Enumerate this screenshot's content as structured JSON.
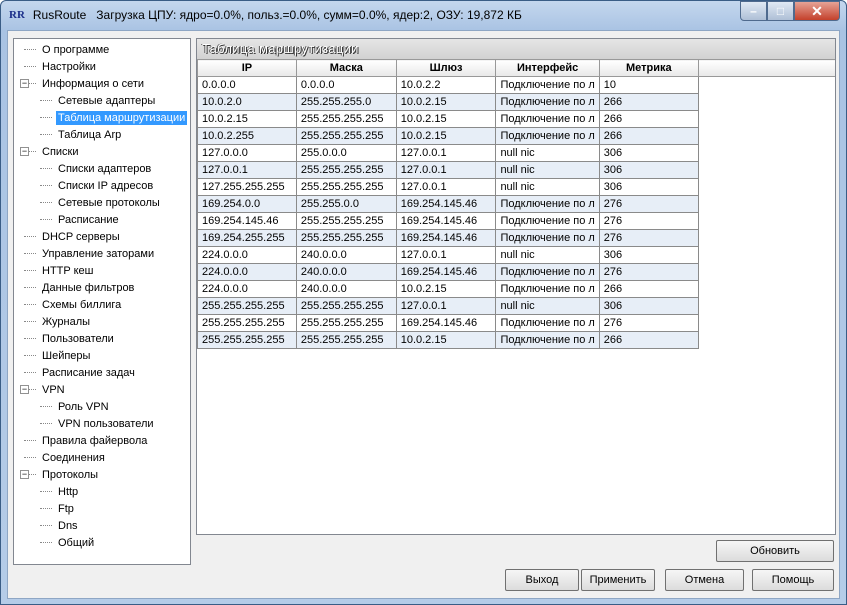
{
  "window": {
    "logo": "RR",
    "app_name": "RusRoute",
    "status": "Загрузка ЦПУ: ядро=0.0%, польз.=0.0%, сумм=0.0%, ядер:2,  ОЗУ: 19,872 КБ"
  },
  "tree": [
    {
      "label": "О программе",
      "level": 0
    },
    {
      "label": "Настройки",
      "level": 0
    },
    {
      "label": "Информация о сети",
      "level": 0,
      "expanded": true
    },
    {
      "label": "Сетевые адаптеры",
      "level": 1
    },
    {
      "label": "Таблица маршрутизации",
      "level": 1,
      "selected": true
    },
    {
      "label": "Таблица Arp",
      "level": 1
    },
    {
      "label": "Списки",
      "level": 0,
      "expanded": true
    },
    {
      "label": "Списки адаптеров",
      "level": 1
    },
    {
      "label": "Списки IP адресов",
      "level": 1
    },
    {
      "label": "Сетевые протоколы",
      "level": 1
    },
    {
      "label": "Расписание",
      "level": 1
    },
    {
      "label": "DHCP серверы",
      "level": 0
    },
    {
      "label": "Управление заторами",
      "level": 0
    },
    {
      "label": "HTTP кеш",
      "level": 0
    },
    {
      "label": "Данные фильтров",
      "level": 0
    },
    {
      "label": "Схемы биллига",
      "level": 0
    },
    {
      "label": "Журналы",
      "level": 0
    },
    {
      "label": "Пользователи",
      "level": 0
    },
    {
      "label": "Шейперы",
      "level": 0
    },
    {
      "label": "Расписание задач",
      "level": 0
    },
    {
      "label": "VPN",
      "level": 0,
      "expanded": true
    },
    {
      "label": "Роль VPN",
      "level": 1
    },
    {
      "label": "VPN пользователи",
      "level": 1
    },
    {
      "label": "Правила файервола",
      "level": 0
    },
    {
      "label": "Соединения",
      "level": 0
    },
    {
      "label": "Протоколы",
      "level": 0,
      "expanded": true
    },
    {
      "label": "Http",
      "level": 1
    },
    {
      "label": "Ftp",
      "level": 1
    },
    {
      "label": "Dns",
      "level": 1
    },
    {
      "label": "Общий",
      "level": 1
    }
  ],
  "panel": {
    "title": "Таблица маршрутизации",
    "columns": [
      "IP",
      "Маска",
      "Шлюз",
      "Интерфейс",
      "Метрика"
    ],
    "rows": [
      [
        "0.0.0.0",
        "0.0.0.0",
        "10.0.2.2",
        "Подключение по л",
        "10"
      ],
      [
        "10.0.2.0",
        "255.255.255.0",
        "10.0.2.15",
        "Подключение по л",
        "266"
      ],
      [
        "10.0.2.15",
        "255.255.255.255",
        "10.0.2.15",
        "Подключение по л",
        "266"
      ],
      [
        "10.0.2.255",
        "255.255.255.255",
        "10.0.2.15",
        "Подключение по л",
        "266"
      ],
      [
        "127.0.0.0",
        "255.0.0.0",
        "127.0.0.1",
        "null nic",
        "306"
      ],
      [
        "127.0.0.1",
        "255.255.255.255",
        "127.0.0.1",
        "null nic",
        "306"
      ],
      [
        "127.255.255.255",
        "255.255.255.255",
        "127.0.0.1",
        "null nic",
        "306"
      ],
      [
        "169.254.0.0",
        "255.255.0.0",
        "169.254.145.46",
        "Подключение по л",
        "276"
      ],
      [
        "169.254.145.46",
        "255.255.255.255",
        "169.254.145.46",
        "Подключение по л",
        "276"
      ],
      [
        "169.254.255.255",
        "255.255.255.255",
        "169.254.145.46",
        "Подключение по л",
        "276"
      ],
      [
        "224.0.0.0",
        "240.0.0.0",
        "127.0.0.1",
        "null nic",
        "306"
      ],
      [
        "224.0.0.0",
        "240.0.0.0",
        "169.254.145.46",
        "Подключение по л",
        "276"
      ],
      [
        "224.0.0.0",
        "240.0.0.0",
        "10.0.2.15",
        "Подключение по л",
        "266"
      ],
      [
        "255.255.255.255",
        "255.255.255.255",
        "127.0.0.1",
        "null nic",
        "306"
      ],
      [
        "255.255.255.255",
        "255.255.255.255",
        "169.254.145.46",
        "Подключение по л",
        "276"
      ],
      [
        "255.255.255.255",
        "255.255.255.255",
        "10.0.2.15",
        "Подключение по л",
        "266"
      ]
    ]
  },
  "buttons": {
    "refresh": "Обновить",
    "exit": "Выход",
    "apply": "Применить",
    "cancel": "Отмена",
    "help": "Помощь"
  }
}
